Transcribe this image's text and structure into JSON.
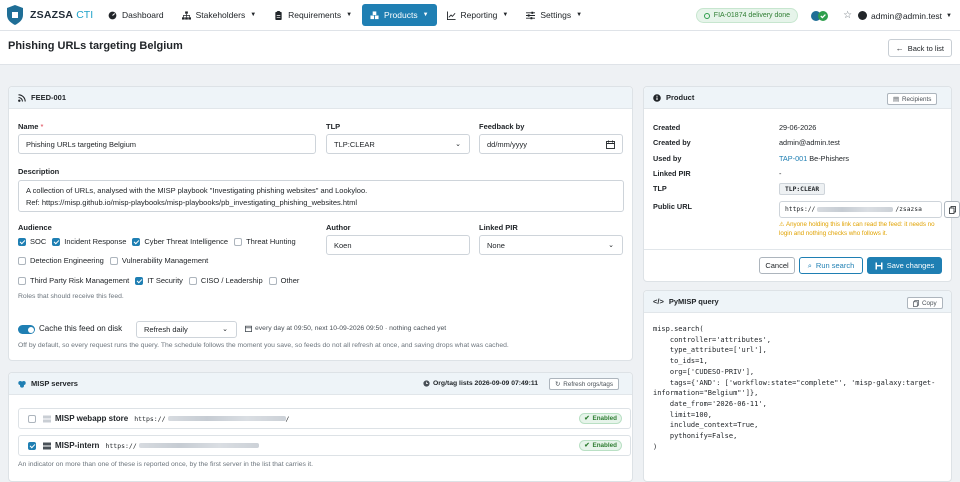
{
  "nav": {
    "brand": "ZSAZSA",
    "brand_suffix": "CTI",
    "items": [
      {
        "label": "Dashboard"
      },
      {
        "label": "Stakeholders"
      },
      {
        "label": "Requirements"
      },
      {
        "label": "Products"
      },
      {
        "label": "Reporting"
      },
      {
        "label": "Settings"
      }
    ],
    "build_badge": "FIA-01874 delivery done",
    "user": "admin@admin.test"
  },
  "page": {
    "title": "Phishing URLs targeting Belgium",
    "back_button": "Back to list"
  },
  "feed": {
    "header": "FEED-001",
    "name_label": "Name",
    "name_required_mark": "*",
    "name_value": "Phishing URLs targeting Belgium",
    "tlp_label": "TLP",
    "tlp_value": "TLP:CLEAR",
    "feedback_label": "Feedback by",
    "feedback_placeholder": "dd/mm/yyyy",
    "description_label": "Description",
    "description_line1": "A collection of URLs, analysed with the MISP playbook \"Investigating phishing websites\" and Lookyloo.",
    "description_line2": "Ref: https://misp.github.io/misp-playbooks/misp-playbooks/pb_investigating_phishing_websites.html",
    "audience_label": "Audience",
    "audience_row1": [
      {
        "label": "SOC",
        "checked": true
      },
      {
        "label": "Incident Response",
        "checked": true
      },
      {
        "label": "Cyber Threat Intelligence",
        "checked": true
      },
      {
        "label": "Threat Hunting",
        "checked": false
      }
    ],
    "audience_row2": [
      {
        "label": "Detection Engineering",
        "checked": false
      },
      {
        "label": "Vulnerability Management",
        "checked": false
      }
    ],
    "audience_row3": [
      {
        "label": "Third Party Risk Management",
        "checked": false
      },
      {
        "label": "IT Security",
        "checked": true
      },
      {
        "label": "CISO / Leadership",
        "checked": false
      },
      {
        "label": "Other",
        "checked": false
      }
    ],
    "audience_help": "Roles that should receive this feed.",
    "author_label": "Author",
    "author_value": "Koen",
    "linked_pir_label": "Linked PIR",
    "linked_pir_value": "None",
    "cache_label": "Cache this feed on disk",
    "cache_enabled": true,
    "refresh_value": "Refresh daily",
    "schedule_text": "every day at 09:50, next 10-09-2026 09:50 · nothing cached yet",
    "cache_help": "Off by default, so every request runs the query. The schedule follows the moment you save, so feeds do not all refresh at once, and saving drops what was cached."
  },
  "misp": {
    "header": "MISP servers",
    "org_tag_lists": "Org/tag lists 2026-09-09 07:49:11",
    "refresh_button": "Refresh orgs/tags",
    "servers": [
      {
        "name": "MISP webapp store",
        "url_prefix": "https://",
        "url_suffix": "/",
        "checked": false,
        "status": "Enabled"
      },
      {
        "name": "MISP-intern",
        "url_prefix": "https://",
        "url_suffix": "",
        "checked": true,
        "status": "Enabled"
      }
    ],
    "footer_note": "An indicator on more than one of these is reported once, by the first server in the list that carries it."
  },
  "product": {
    "header": "Product",
    "recipients_button": "Recipients",
    "created_label": "Created",
    "created_value": "29-06-2026",
    "created_by_label": "Created by",
    "created_by_value": "admin@admin.test",
    "used_by_label": "Used by",
    "used_by_link": "TAP-001",
    "used_by_text": "Be-Phishers",
    "linked_pir_label": "Linked PIR",
    "linked_pir_value": "-",
    "tlp_label": "TLP",
    "tlp_value": "TLP:CLEAR",
    "public_url_label": "Public URL",
    "public_url_prefix": "https://",
    "public_url_suffix": "/zsazsa",
    "public_url_warning": "Anyone holding this link can read the feed: it needs no login and nothing checks who follows it.",
    "cancel_button": "Cancel",
    "run_search_button": "Run search",
    "save_button": "Save changes"
  },
  "pymisp": {
    "header": "PyMISP query",
    "copy_button": "Copy",
    "code": "misp.search(\n    controller='attributes',\n    type_attribute=['url'],\n    to_ids=1,\n    org=['CUDESO-PRIV'],\n    tags={'AND': ['workflow:state=\"complete\"', 'misp-galaxy:target-\ninformation=\"Belgium\"']},\n    date_from='2026-06-11',\n    limit=100,\n    include_context=True,\n    pythonify=False,\n)"
  },
  "colors": {
    "accent": "#1f7fb3",
    "brand_suffix": "#1fa2c9",
    "success": "#2e7d32",
    "warning": "#e0a200",
    "card_header": "#eef4f8"
  }
}
